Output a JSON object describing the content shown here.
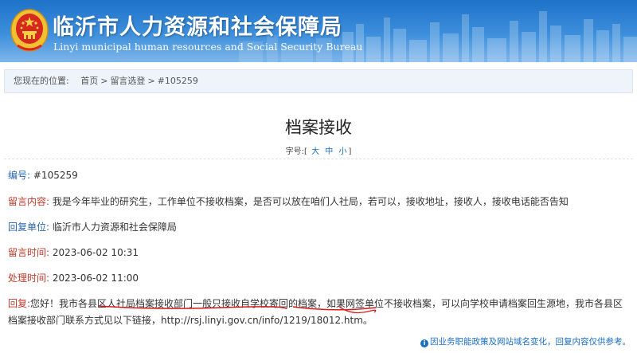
{
  "header": {
    "title": "临沂市人力资源和社会保障局",
    "subtitle": "Linyi municipal human resources and Social Security Bureau"
  },
  "breadcrumb": {
    "prefix": "您现在的位置:",
    "items": [
      "首页",
      "留言选登",
      "#105259"
    ]
  },
  "article": {
    "title": "档案接收",
    "font_size": {
      "label": "字号:",
      "open": "[",
      "close": "]",
      "options": [
        "大",
        "中",
        "小"
      ]
    }
  },
  "fields": [
    {
      "label": "编号:",
      "value": "#105259",
      "label_color": "#2a65b0"
    },
    {
      "label": "留言内容:",
      "value": "我是今年毕业的研究生，工作单位不接收档案，是否可以放在咱们人社局，若可以，接收地址，接收人，接收电话能否告知",
      "label_color": "#c0392b"
    },
    {
      "label": "回复单位:",
      "value": "临沂市人力资源和社会保障局",
      "label_color": "#2a65b0"
    },
    {
      "label": "留言时间:",
      "value": "2023-06-02 10:31",
      "label_color": "#c0392b"
    },
    {
      "label": "处理时间:",
      "value": "2023-06-02 11:00",
      "label_color": "#c0392b"
    }
  ],
  "reply": {
    "label": "回复:",
    "text": "您好！我市各县区人社局档案接收部门一般只接收自学校寄回的档案，如果网签单位不接收档案，可以向学校申请档案回生源地，我市各县区档案接收部门联系方式见以下链接，http://rsj.linyi.gov.cn/info/1219/18012.htm。"
  },
  "notice": "因业务职能政策及网站域名变化，回复内容仅供参考。",
  "colors": {
    "banner": "#2a80d2",
    "label_red": "#c0392b",
    "label_blue": "#2a65b0",
    "link": "#1a6ec2",
    "annotation": "#d11a1a"
  }
}
